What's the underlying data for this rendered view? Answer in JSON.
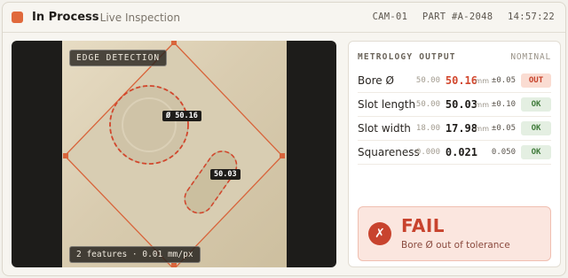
{
  "header": {
    "status": "In Process",
    "subtitle": "· Live Inspection",
    "camera": "CAM-01",
    "part": "PART #A-2048",
    "time": "14:57:22"
  },
  "viewer": {
    "mode_label": "EDGE DETECTION",
    "bore_label": "Ø 50.16",
    "slot_label": "50.03",
    "footer": "2 features · 0.01 mm/px"
  },
  "metrology": {
    "title": "METROLOGY OUTPUT",
    "column": "NOMINAL",
    "rows": [
      {
        "name": "Bore Ø",
        "nominal": "50.00",
        "value": "50.16",
        "unit": "mm",
        "tol": "±0.05",
        "status": "OUT"
      },
      {
        "name": "Slot length",
        "nominal": "50.00",
        "value": "50.03",
        "unit": "mm",
        "tol": "±0.10",
        "status": "OK"
      },
      {
        "name": "Slot width",
        "nominal": "18.00",
        "value": "17.98",
        "unit": "mm",
        "tol": "±0.05",
        "status": "OK"
      },
      {
        "name": "Squareness",
        "nominal": "0.000",
        "value": "0.021",
        "unit": "",
        "tol": "0.050",
        "status": "OK"
      }
    ]
  },
  "verdict": {
    "icon": "x-icon",
    "symbol": "✗",
    "title": "FAIL",
    "message": "Bore Ø out of tolerance"
  },
  "colors": {
    "accent": "#e0693c",
    "fail": "#c8432e",
    "ok": "#3e7a39"
  }
}
